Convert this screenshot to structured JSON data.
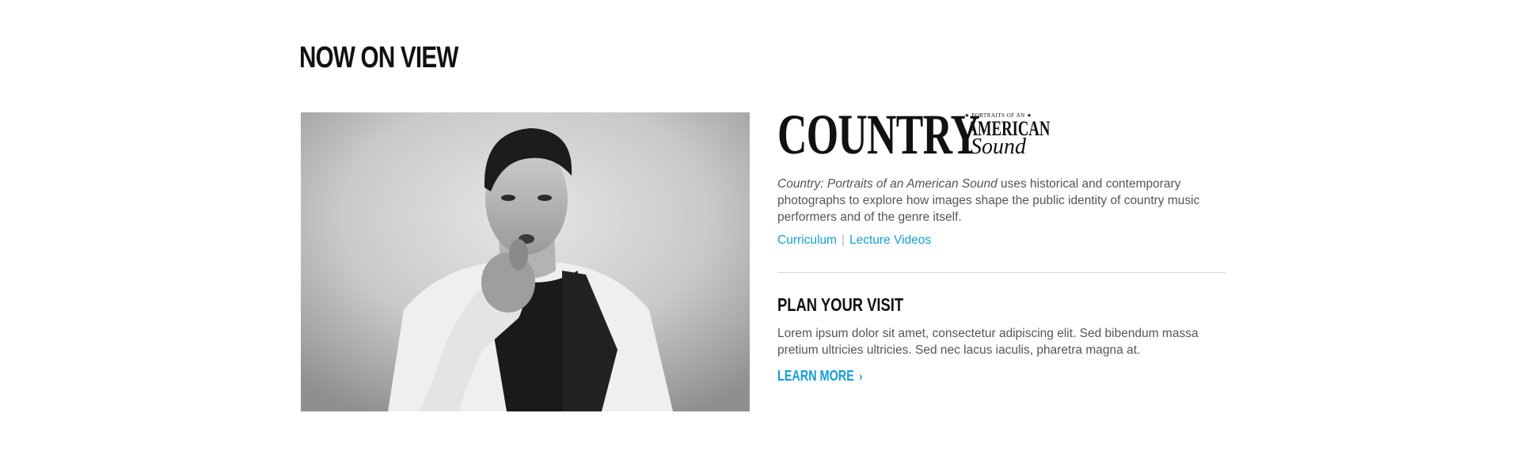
{
  "section": {
    "heading": "NOW ON VIEW"
  },
  "feature": {
    "photo_alt": "Black and white photo of a man in a white shirt and dark vest pointing at the camera",
    "logo": {
      "word": "COUNTRY",
      "portraits": "★ PORTRAITS OF AN ★",
      "american": "AMERICAN",
      "sound": "Sound"
    },
    "description_title": "Country: Portraits of an American Sound",
    "description_rest": " uses historical and contemporary photographs to explore how images shape the public identity of country music performers and of the genre itself.",
    "links": [
      {
        "label": "Curriculum"
      },
      {
        "label": "Lecture Videos"
      }
    ],
    "link_separator": "|"
  },
  "visit": {
    "heading": "PLAN YOUR VISIT",
    "body": "Lorem ipsum dolor sit amet, consectetur adipiscing elit. Sed bibendum massa pretium ultricies ultricies. Sed nec lacus iaculis, pharetra magna at.",
    "cta_label": "LEARN MORE",
    "cta_chevron": "›"
  },
  "colors": {
    "link": "#139ed4",
    "body_text": "#555555",
    "heading": "#111111",
    "divider": "#d6d6d6"
  }
}
